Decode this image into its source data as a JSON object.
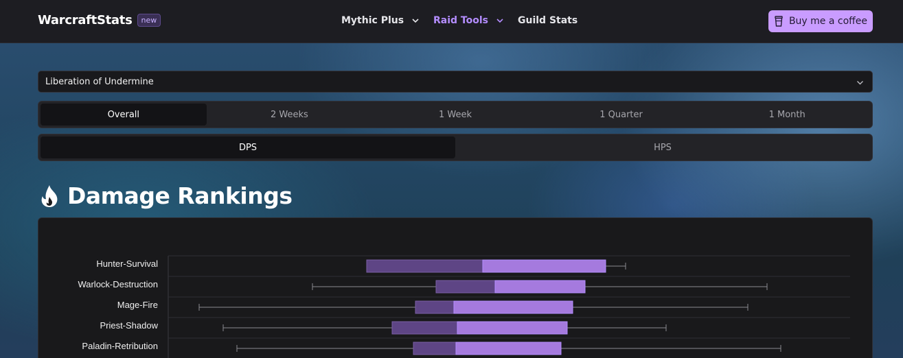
{
  "header": {
    "brand": "WarcraftStats",
    "badge": "new",
    "nav": {
      "mythic": "Mythic Plus",
      "raid": "Raid Tools",
      "guild": "Guild Stats"
    },
    "coffee_label": "Buy me a coffee"
  },
  "raid_select": {
    "value": "Liberation of Undermine"
  },
  "time_tabs": [
    "Overall",
    "2 Weeks",
    "1 Week",
    "1 Quarter",
    "1 Month"
  ],
  "metric_tabs": [
    "DPS",
    "HPS"
  ],
  "section": {
    "title": "Damage Rankings",
    "icon": "fire-icon"
  },
  "colors": {
    "accent": "#b48dff",
    "box_lower": "#5e4585",
    "box_upper": "#a57ade",
    "coffee_bg": "#c99cff"
  },
  "chart_data": {
    "type": "boxplot",
    "orientation": "horizontal",
    "categories": [
      "Hunter-Survival",
      "Warlock-Destruction",
      "Mage-Fire",
      "Priest-Shadow",
      "Paladin-Retribution"
    ],
    "series": [
      {
        "min": 533,
        "q1": 533,
        "median": 702,
        "q3": 881,
        "max": 910
      },
      {
        "min": 454,
        "q1": 634,
        "median": 720,
        "q3": 851,
        "max": 1116
      },
      {
        "min": 289,
        "q1": 604,
        "median": 660,
        "q3": 833,
        "max": 1088
      },
      {
        "min": 324,
        "q1": 570,
        "median": 665,
        "q3": 825,
        "max": 969
      },
      {
        "min": 344,
        "q1": 601,
        "median": 663,
        "q3": 816,
        "max": 1136
      }
    ],
    "xlim": [
      244,
      1237
    ],
    "grid": true
  }
}
